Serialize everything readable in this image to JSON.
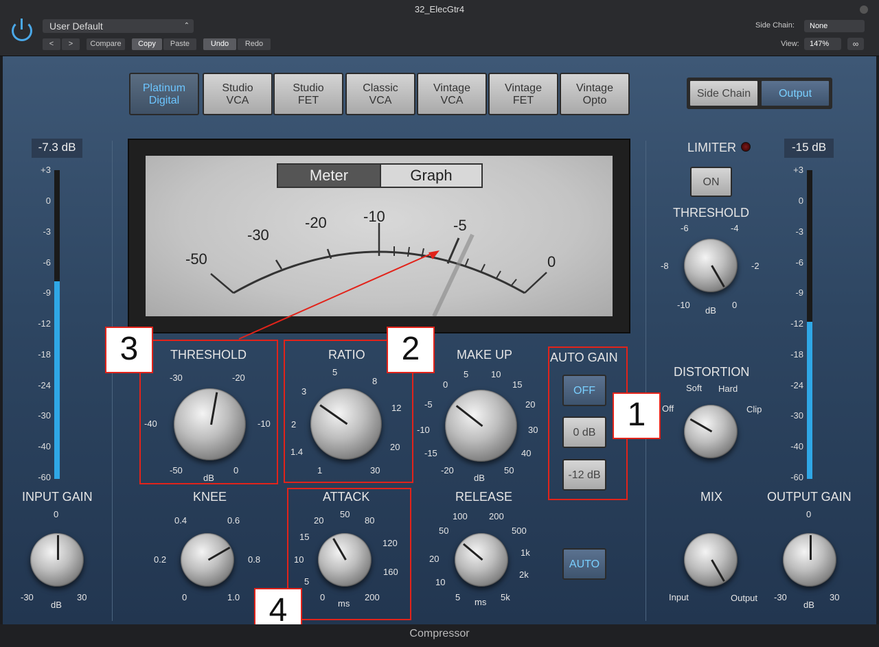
{
  "window": {
    "title": "32_ElecGtr4"
  },
  "toolbar": {
    "preset": "User Default",
    "compare": "Compare",
    "copy": "Copy",
    "paste": "Paste",
    "undo": "Undo",
    "redo": "Redo",
    "sidechain_label": "Side Chain:",
    "sidechain_value": "None",
    "view_label": "View:",
    "view_value": "147%"
  },
  "models": [
    "Platinum\nDigital",
    "Studio\nVCA",
    "Studio\nFET",
    "Classic\nVCA",
    "Vintage\nVCA",
    "Vintage\nFET",
    "Vintage\nOpto"
  ],
  "routing": {
    "sidechain": "Side Chain",
    "output": "Output"
  },
  "meter": {
    "tab_meter": "Meter",
    "tab_graph": "Graph",
    "scale": [
      "-50",
      "-30",
      "-20",
      "-10",
      "-5",
      "0"
    ],
    "needle_db": -5
  },
  "input": {
    "readout": "-7.3 dB",
    "label": "INPUT GAIN",
    "ticks": {
      "top": "0",
      "left": "-30",
      "right": "30",
      "unit": "dB"
    },
    "level": 0.64
  },
  "output": {
    "readout": "-15 dB",
    "label": "OUTPUT GAIN",
    "ticks": {
      "top": "0",
      "left": "-30",
      "right": "30",
      "unit": "dB"
    },
    "level": 0.51
  },
  "meter_scale": [
    "+3",
    "0",
    "-3",
    "-6",
    "-9",
    "-12",
    "-18",
    "-24",
    "-30",
    "-40",
    "-60"
  ],
  "threshold": {
    "label": "THRESHOLD",
    "ticks": [
      "-30",
      "-20",
      "-40",
      "-10",
      "-50",
      "0"
    ],
    "unit": "dB"
  },
  "ratio": {
    "label": "RATIO",
    "ticks": [
      "5",
      "8",
      "3",
      "12",
      "2",
      "20",
      "1.4",
      "1",
      "30"
    ]
  },
  "makeup": {
    "label": "MAKE UP",
    "ticks": [
      "0",
      "5",
      "10",
      "15",
      "-5",
      "20",
      "-10",
      "30",
      "-15",
      "40",
      "-20",
      "50"
    ],
    "unit": "dB"
  },
  "autogain": {
    "label": "AUTO GAIN",
    "off": "OFF",
    "zero": "0 dB",
    "minus12": "-12 dB"
  },
  "knee": {
    "label": "KNEE",
    "ticks": [
      "0.4",
      "0.6",
      "0.2",
      "0.8",
      "0",
      "1.0"
    ]
  },
  "attack": {
    "label": "ATTACK",
    "ticks": [
      "20",
      "50",
      "80",
      "15",
      "120",
      "10",
      "160",
      "5",
      "0",
      "200"
    ],
    "unit": "ms"
  },
  "release": {
    "label": "RELEASE",
    "ticks": [
      "100",
      "200",
      "50",
      "500",
      "1k",
      "20",
      "2k",
      "10",
      "5",
      "5k"
    ],
    "unit": "ms",
    "auto": "AUTO"
  },
  "limiter": {
    "label": "LIMITER",
    "on": "ON",
    "threshold_label": "THRESHOLD",
    "ticks": [
      "-6",
      "-4",
      "-8",
      "-2",
      "-10",
      "0"
    ],
    "unit": "dB"
  },
  "distortion": {
    "label": "DISTORTION",
    "soft": "Soft",
    "hard": "Hard",
    "off": "Off",
    "clip": "Clip"
  },
  "mix": {
    "label": "MIX",
    "input": "Input",
    "output": "Output"
  },
  "annotations": [
    "1",
    "2",
    "3",
    "4"
  ],
  "footer": "Compressor"
}
